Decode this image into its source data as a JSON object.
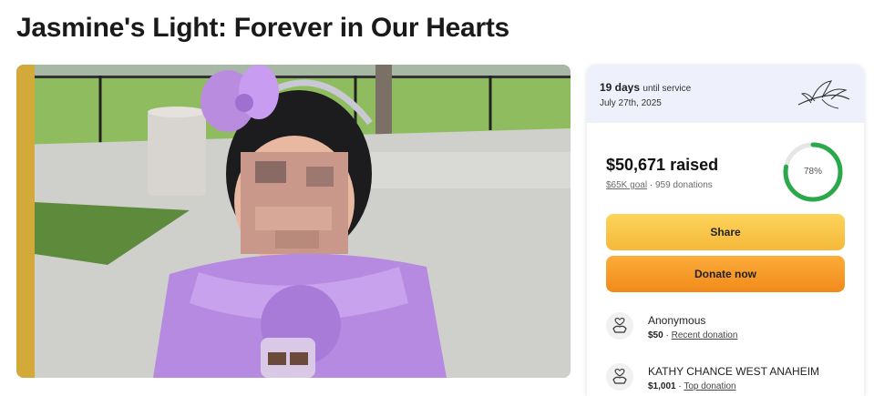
{
  "page": {
    "title": "Jasmine's Light: Forever in Our Hearts"
  },
  "photo": {
    "description_icon": "photo-icon"
  },
  "service": {
    "days": "19 days",
    "until": "until service",
    "date": "July 27th, 2025",
    "icon": "lily-flower-icon"
  },
  "fundraiser": {
    "raised": "$50,671 raised",
    "goal": "$65K goal",
    "separator": "·",
    "donations": "959 donations",
    "progress_label": "78%",
    "progress_value": 0.78
  },
  "buttons": {
    "share": "Share",
    "donate": "Donate now"
  },
  "donors": [
    {
      "name": "Anonymous",
      "amount": "$50",
      "separator": "·",
      "tag": "Recent donation"
    },
    {
      "name": "KATHY CHANCE WEST ANAHEIM",
      "amount": "$1,001",
      "separator": "·",
      "tag": "Top donation"
    }
  ],
  "colors": {
    "ring": "#2aa84a",
    "share": "#f8c444",
    "donate": "#f39a24",
    "card_top": "#eef1fb"
  }
}
